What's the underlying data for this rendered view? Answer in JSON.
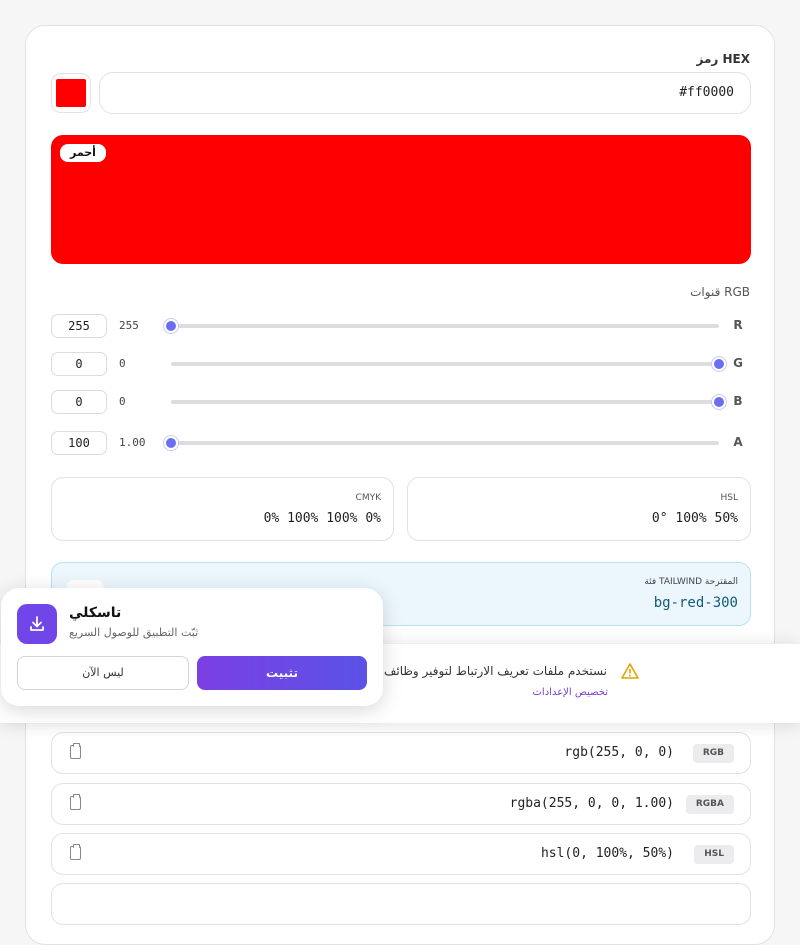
{
  "hex": {
    "label": "رمز HEX",
    "value": "#ff0000"
  },
  "color": {
    "value": "#ff0000",
    "name": "أحمر"
  },
  "rgb_section": {
    "title": "قنوات RGB"
  },
  "channels": [
    {
      "letter": "R",
      "input": "255",
      "value": "255",
      "level": 1.0
    },
    {
      "letter": "G",
      "input": "0",
      "value": "0",
      "level": 0.0
    },
    {
      "letter": "B",
      "input": "0",
      "value": "0",
      "level": 0.0
    },
    {
      "letter": "A",
      "input": "100",
      "value": "1.00",
      "level": 1.0
    }
  ],
  "formats": {
    "hsl": {
      "label": "HSL",
      "value": "0° 100% 50%"
    },
    "cmyk": {
      "label": "CMYK",
      "value": "0% 100% 100% 0%"
    }
  },
  "tailwind": {
    "label": "فئة TAILWIND المقترحة",
    "value": "bg-red-300"
  },
  "code_rows": [
    {
      "tag": "RGB",
      "text": "rgb(255, 0, 0)"
    },
    {
      "tag": "RGBA",
      "text": "rgba(255, 0, 0, 1.00)"
    },
    {
      "tag": "HSL",
      "text": "hsl(0, 100%, 50%)"
    }
  ],
  "cookie": {
    "message": "نستخدم ملفات تعريف الارتباط لتوفير وظائف أس",
    "link": "تخصيص الإعدادات"
  },
  "install_prompt": {
    "title": "تاسكلي",
    "subtitle": "ثبّت التطبيق للوصول السريع",
    "install_label": "تثبيت",
    "later_label": "ليس الآن"
  },
  "colors": {
    "accent": "#6b6ef0",
    "install_gradient": "#7b3fe4"
  }
}
